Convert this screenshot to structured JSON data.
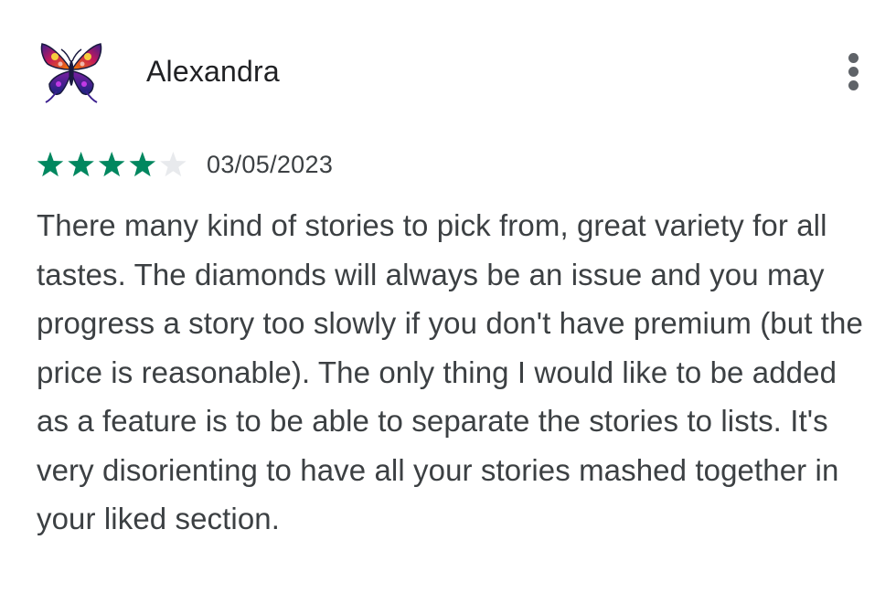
{
  "review": {
    "author_name": "Alexandra",
    "avatar_icon": "butterfly-avatar-icon",
    "more_icon": "more-vert-icon",
    "rating": 4,
    "rating_max": 5,
    "date": "03/05/2023",
    "text": "There many kind of stories to pick from, great variety for all tastes. The diamonds will always be an issue and you may progress a story too slowly if you don't have premium (but the price is reasonable). The only thing I would like to be added as a feature is to be able to separate the stories to lists. It's very disorienting to have all your stories mashed together in your liked section."
  },
  "colors": {
    "star_filled": "#01875f",
    "star_empty": "#e8eaed",
    "text": "#3c4043",
    "name": "#202124",
    "icon": "#5f6368"
  }
}
